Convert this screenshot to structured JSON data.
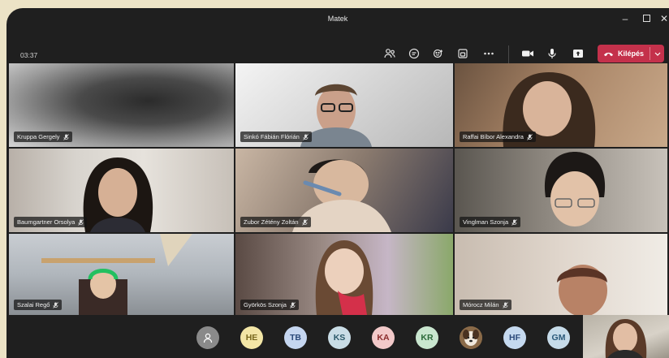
{
  "window": {
    "title": "Matek"
  },
  "toolbar": {
    "elapsed": "03:37",
    "leave_label": "Kilépés"
  },
  "participants": [
    {
      "name": "Kruppa Gergely"
    },
    {
      "name": "Sinkó Fábián Flórián"
    },
    {
      "name": "Raffai Bíbor Alexandra"
    },
    {
      "name": "Baumgartner Orsolya"
    },
    {
      "name": "Zubor Zétény Zoltán"
    },
    {
      "name": "Vinglman Szonja"
    },
    {
      "name": "Szalai Regő"
    },
    {
      "name": "Györkös Szonja"
    },
    {
      "name": "Mórocz Milán"
    }
  ],
  "more_participants": [
    {
      "initials": "",
      "icon": "person-icon",
      "color": "#8a8a8a"
    },
    {
      "initials": "HE",
      "color": "#f3e6a6"
    },
    {
      "initials": "TB",
      "color": "#c5d6f0"
    },
    {
      "initials": "KS",
      "color": "#c9dde6"
    },
    {
      "initials": "KA",
      "color": "#f2c9c9"
    },
    {
      "initials": "KR",
      "color": "#c9e6cf"
    },
    {
      "initials": "",
      "icon": "dog-photo",
      "color": "#7a5a3a"
    },
    {
      "initials": "HF",
      "color": "#c5d9ef"
    },
    {
      "initials": "GM",
      "color": "#c6dbe9"
    }
  ],
  "colors": {
    "leave": "#c4314b",
    "background": "#1f1f1f"
  }
}
